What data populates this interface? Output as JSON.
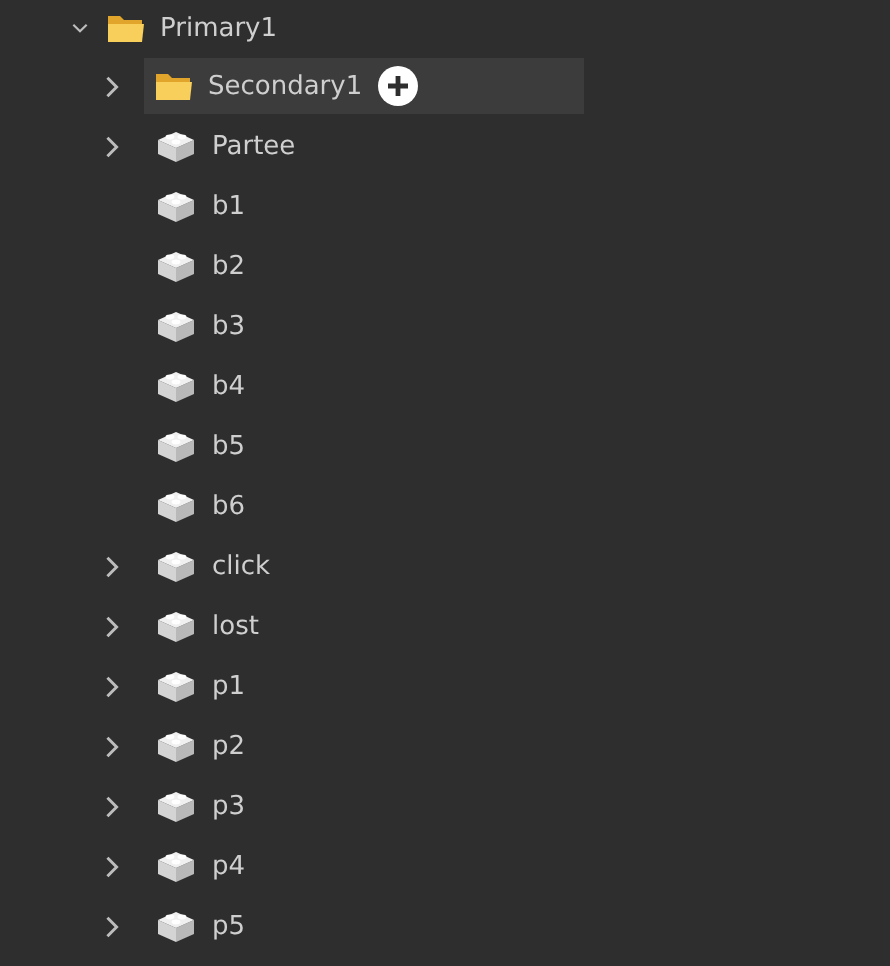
{
  "tree": {
    "name": "Primary1",
    "kind": "folder",
    "expanded": true,
    "children": [
      {
        "name": "Secondary1",
        "kind": "folder",
        "expandable": true,
        "selected": true
      },
      {
        "name": "Partee",
        "kind": "part",
        "expandable": true,
        "selected": false
      },
      {
        "name": "b1",
        "kind": "part",
        "expandable": false,
        "selected": false
      },
      {
        "name": "b2",
        "kind": "part",
        "expandable": false,
        "selected": false
      },
      {
        "name": "b3",
        "kind": "part",
        "expandable": false,
        "selected": false
      },
      {
        "name": "b4",
        "kind": "part",
        "expandable": false,
        "selected": false
      },
      {
        "name": "b5",
        "kind": "part",
        "expandable": false,
        "selected": false
      },
      {
        "name": "b6",
        "kind": "part",
        "expandable": false,
        "selected": false
      },
      {
        "name": "click",
        "kind": "part",
        "expandable": true,
        "selected": false
      },
      {
        "name": "lost",
        "kind": "part",
        "expandable": true,
        "selected": false
      },
      {
        "name": "p1",
        "kind": "part",
        "expandable": true,
        "selected": false
      },
      {
        "name": "p2",
        "kind": "part",
        "expandable": true,
        "selected": false
      },
      {
        "name": "p3",
        "kind": "part",
        "expandable": true,
        "selected": false
      },
      {
        "name": "p4",
        "kind": "part",
        "expandable": true,
        "selected": false
      },
      {
        "name": "p5",
        "kind": "part",
        "expandable": true,
        "selected": false
      }
    ]
  }
}
